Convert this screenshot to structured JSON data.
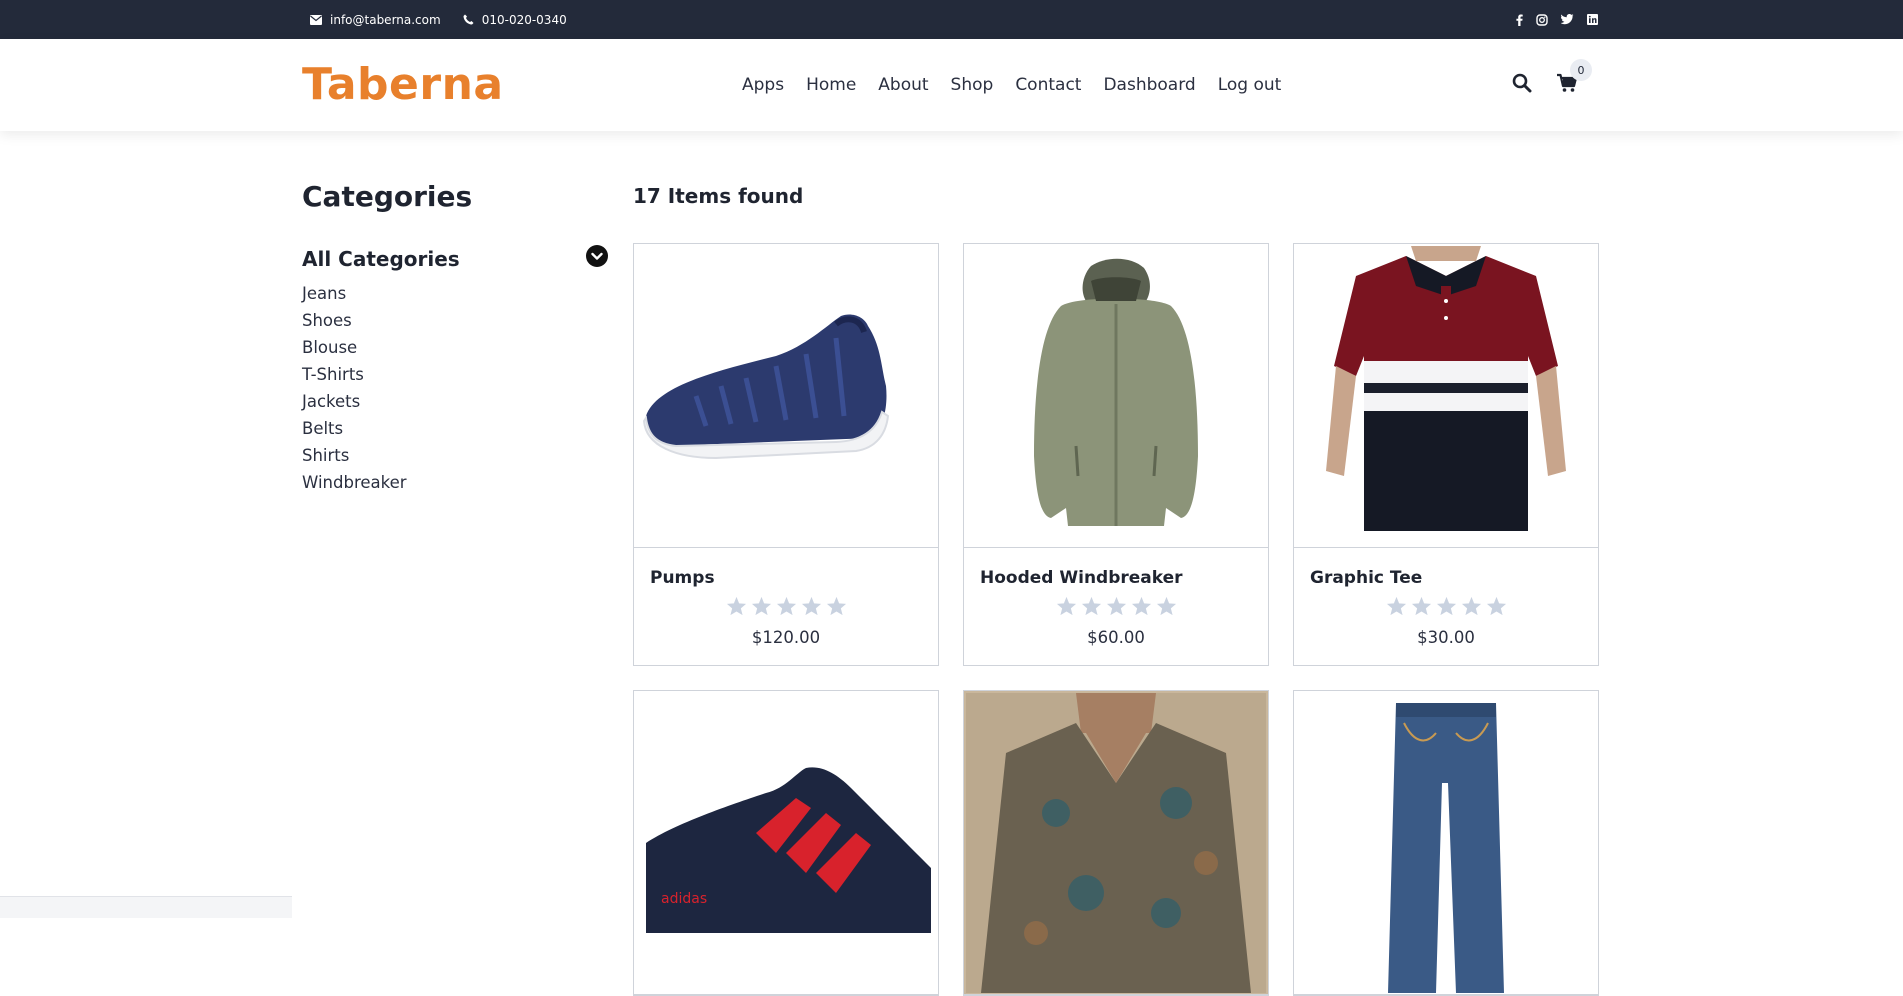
{
  "topbar": {
    "email": "info@taberna.com",
    "phone": "010-020-0340",
    "social": [
      "facebook-icon",
      "instagram-icon",
      "twitter-icon",
      "linkedin-icon"
    ]
  },
  "header": {
    "logo": "Taberna",
    "nav": [
      "Apps",
      "Home",
      "About",
      "Shop",
      "Contact",
      "Dashboard",
      "Log out"
    ],
    "cart_count": "0"
  },
  "sidebar": {
    "title": "Categories",
    "all_label": "All Categories",
    "categories": [
      "Jeans",
      "Shoes",
      "Blouse",
      "T-Shirts",
      "Jackets",
      "Belts",
      "Shirts",
      "Windbreaker"
    ]
  },
  "main": {
    "count_text": "17 Items found",
    "products": [
      {
        "name": "Pumps",
        "price": "$120.00",
        "rating": 0
      },
      {
        "name": "Hooded Windbreaker",
        "price": "$60.00",
        "rating": 0
      },
      {
        "name": "Graphic Tee",
        "price": "$30.00",
        "rating": 0
      },
      {
        "name": "",
        "price": "",
        "rating": 0
      },
      {
        "name": "",
        "price": "",
        "rating": 0
      },
      {
        "name": "",
        "price": "",
        "rating": 0
      }
    ]
  },
  "colors": {
    "accent": "#e8802c",
    "topbar": "#232a3a",
    "star": "#c9d2e0"
  }
}
